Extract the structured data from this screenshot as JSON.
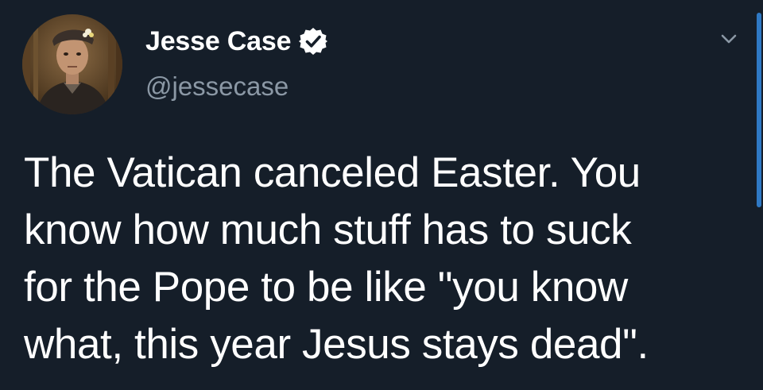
{
  "tweet": {
    "author": {
      "display_name": "Jesse Case",
      "handle": "@jessecase",
      "verified": true,
      "avatar_icon": "profile-photo"
    },
    "text_lines": [
      "The Vatican canceled Easter. You",
      "know how much stuff has to suck",
      "for the Pope to be like \"you know",
      "what, this year Jesus stays dead\"."
    ],
    "menu_icon": "chevron-down-icon"
  },
  "colors": {
    "background": "#151e29",
    "text_primary": "#ffffff",
    "text_secondary": "#8b98a5",
    "accent": "#2f79c4"
  }
}
